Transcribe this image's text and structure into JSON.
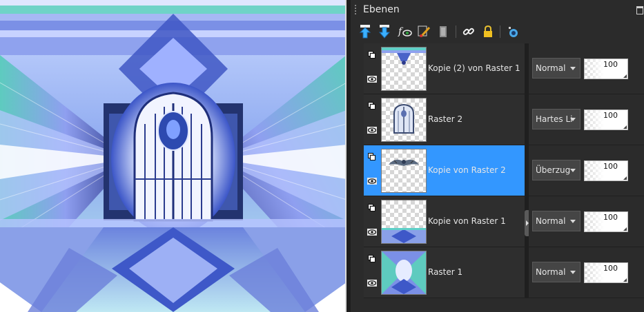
{
  "panel": {
    "title": "Ebenen"
  },
  "toolbar": {
    "buttons": [
      {
        "icon": "move-layer-up-icon"
      },
      {
        "icon": "move-layer-down-icon"
      },
      {
        "icon": "layer-effects-icon"
      },
      {
        "icon": "edit-brush-icon"
      },
      {
        "icon": "delete-layer-icon"
      },
      {
        "icon": "link-icon"
      },
      {
        "icon": "lock-icon"
      },
      {
        "icon": "new-layer-icon"
      }
    ]
  },
  "layers": [
    {
      "name": "Kopie (2) von Raster 1",
      "blend_mode": "Normal",
      "opacity": "100",
      "selected": false
    },
    {
      "name": "Raster 2",
      "blend_mode": "Hartes Licht",
      "opacity": "100",
      "selected": false
    },
    {
      "name": "Kopie von Raster 2",
      "blend_mode": "Überzug",
      "opacity": "100",
      "selected": true
    },
    {
      "name": "Kopie von Raster 1",
      "blend_mode": "Normal",
      "opacity": "100",
      "selected": false
    },
    {
      "name": "Raster 1",
      "blend_mode": "Normal",
      "opacity": "100",
      "selected": false
    }
  ],
  "colors": {
    "selection": "#3397ff",
    "panel_bg": "#2b2b2b",
    "canvas_blue": "#6f8fe0",
    "canvas_teal": "#5fd0c8",
    "canvas_lavender": "#b9b3f0"
  }
}
